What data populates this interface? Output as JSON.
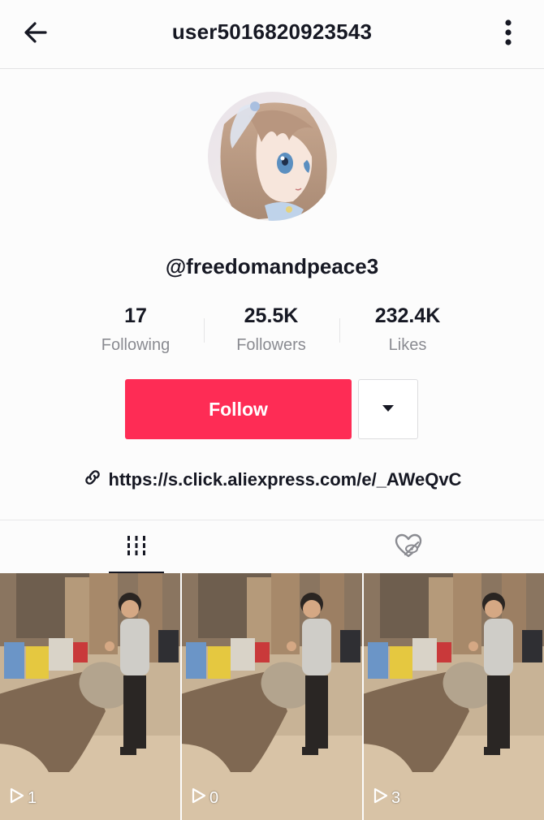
{
  "header": {
    "title": "user5016820923543",
    "back_icon": "arrow-left-icon",
    "more_icon": "more-vertical-icon"
  },
  "profile": {
    "handle": "@freedomandpeace3",
    "avatar": "anime-girl-avatar"
  },
  "stats": [
    {
      "value": "17",
      "label": "Following"
    },
    {
      "value": "25.5K",
      "label": "Followers"
    },
    {
      "value": "232.4K",
      "label": "Likes"
    }
  ],
  "actions": {
    "follow_label": "Follow",
    "follow_color": "#fe2c55",
    "dropdown_icon": "caret-down-icon"
  },
  "bio": {
    "link_icon": "link-icon",
    "link_text": "https://s.click.aliexpress.com/e/_AWeQvC"
  },
  "tabs": [
    {
      "name": "videos",
      "icon": "grid-bars-icon",
      "active": true
    },
    {
      "name": "liked",
      "icon": "heart-hidden-icon",
      "active": false
    }
  ],
  "videos": [
    {
      "views": "1"
    },
    {
      "views": "0"
    },
    {
      "views": "3"
    }
  ]
}
